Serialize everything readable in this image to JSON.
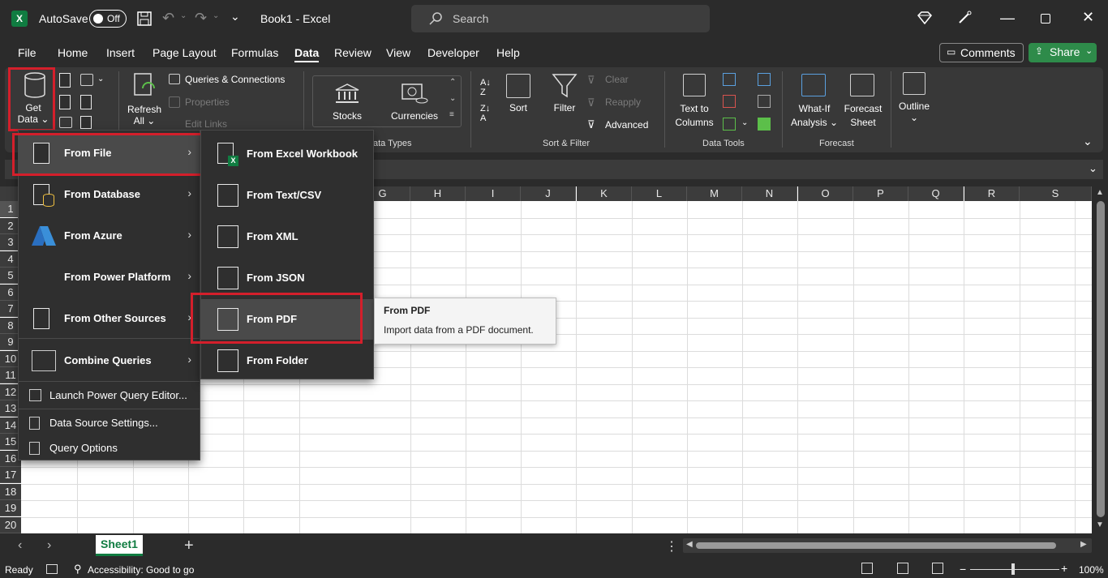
{
  "titlebar": {
    "logo": "X",
    "autosave_label": "AutoSave",
    "autosave_state": "Off",
    "doc_title": "Book1  -  Excel",
    "search_placeholder": "Search"
  },
  "menu_tabs": [
    "File",
    "Home",
    "Insert",
    "Page Layout",
    "Formulas",
    "Data",
    "Review",
    "View",
    "Developer",
    "Help"
  ],
  "active_tab": "Data",
  "top_buttons": {
    "comments": "Comments",
    "share": "Share"
  },
  "ribbon": {
    "get_data": [
      "Get",
      "Data"
    ],
    "queries_connections": "Queries & Connections",
    "properties": "Properties",
    "edit_links": "Edit Links",
    "refresh": [
      "Refresh",
      "All"
    ],
    "stocks": "Stocks",
    "currencies": "Currencies",
    "data_types_label": "Data Types",
    "data_types_partial": "ata Types",
    "sort": "Sort",
    "filter": "Filter",
    "clear": "Clear",
    "reapply": "Reapply",
    "advanced": "Advanced",
    "sort_filter_label": "Sort & Filter",
    "text_to_columns": [
      "Text to",
      "Columns"
    ],
    "data_tools_label": "Data Tools",
    "what_if": [
      "What-If",
      "Analysis"
    ],
    "forecast_sheet": [
      "Forecast",
      "Sheet"
    ],
    "forecast_label": "Forecast",
    "outline": "Outline"
  },
  "columns": [
    "G",
    "H",
    "I",
    "J",
    "K",
    "L",
    "M",
    "N",
    "O",
    "P",
    "Q",
    "R",
    "S"
  ],
  "rows": [
    "1",
    "2",
    "3",
    "4",
    "5",
    "6",
    "7",
    "8",
    "9",
    "10",
    "11",
    "12",
    "13",
    "14",
    "15",
    "16",
    "17",
    "18",
    "19",
    "20"
  ],
  "get_data_menu": {
    "items": [
      {
        "label": "From File",
        "has_sub": true
      },
      {
        "label": "From Database",
        "has_sub": true
      },
      {
        "label": "From Azure",
        "has_sub": true
      },
      {
        "label": "From Power Platform",
        "has_sub": true
      },
      {
        "label": "From Other Sources",
        "has_sub": true
      },
      {
        "label": "Combine Queries",
        "has_sub": true
      }
    ],
    "small_items": [
      "Launch Power Query Editor...",
      "Data Source Settings...",
      "Query Options"
    ]
  },
  "from_file_menu": {
    "items": [
      "From Excel Workbook",
      "From Text/CSV",
      "From XML",
      "From JSON",
      "From PDF",
      "From Folder"
    ]
  },
  "tooltip": {
    "title": "From PDF",
    "description": "Import data from a PDF document."
  },
  "sheet_tabs": {
    "active": "Sheet1"
  },
  "statusbar": {
    "ready": "Ready",
    "accessibility": "Accessibility: Good to go",
    "zoom": "100%"
  },
  "colors": {
    "excel_green": "#107c41",
    "highlight_red": "#d41f2b",
    "share_green": "#2e8b4a"
  }
}
